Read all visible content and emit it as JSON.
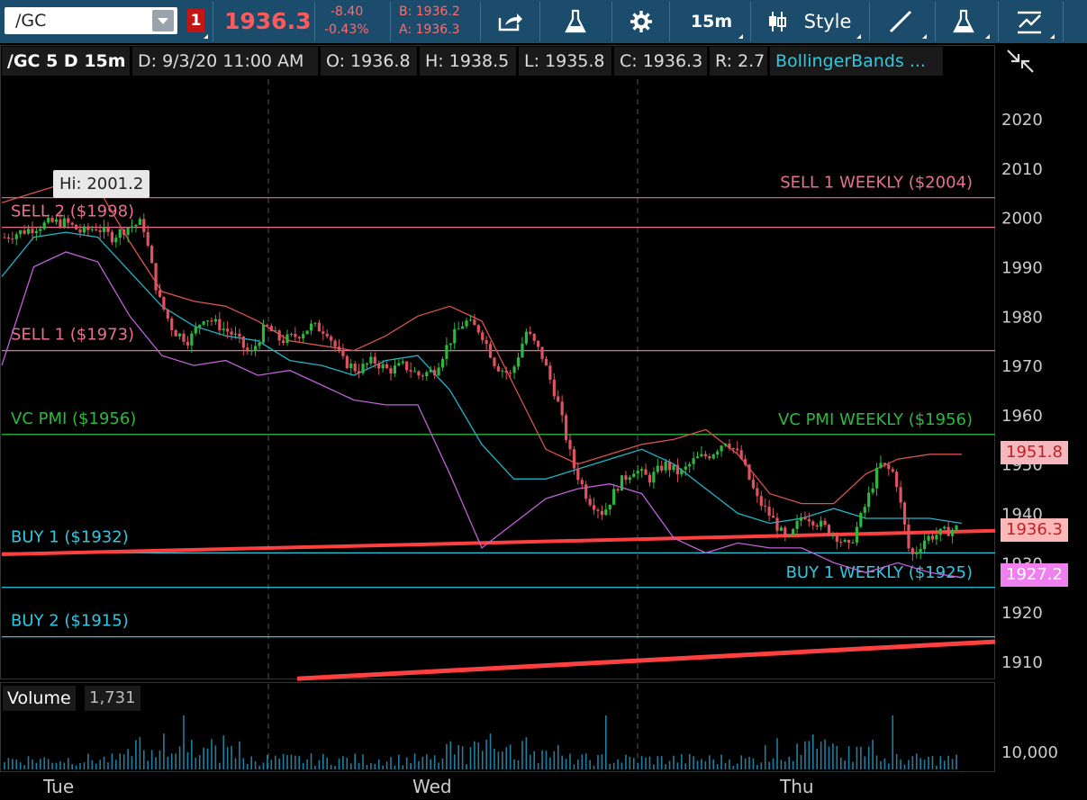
{
  "toolbar": {
    "symbol": "/GC",
    "link_badge": "1",
    "last_price": "1936.3",
    "net_change": "-8.40",
    "pct_change": "-0.43%",
    "bid": "B: 1936.2",
    "ask": "A: 1936.3",
    "timeframe": "15m",
    "style_label": "Style"
  },
  "info": {
    "title": "/GC 5 D 15m",
    "date": "D: 9/3/20 11:00 AM",
    "open": "O: 1936.8",
    "high": "H: 1938.5",
    "low": "L: 1935.8",
    "close": "C: 1936.3",
    "range": "R: 2.7",
    "study": "BollingerBands ..."
  },
  "hi_marker": "Hi: 2001.2",
  "price_axis": [
    "2020",
    "2010",
    "2000",
    "1990",
    "1980",
    "1970",
    "1960",
    "1950",
    "1940",
    "1930",
    "1920",
    "1910"
  ],
  "price_tags": {
    "upper": "1951.8",
    "last": "1936.3",
    "lower": "1927.2"
  },
  "levels": [
    {
      "label": "SELL 1 WEEKLY ($2004)",
      "price": 2004,
      "color": "#e87090",
      "side": "right"
    },
    {
      "label": "SELL 2 ($1998)",
      "price": 1998,
      "color": "#e87090",
      "side": "left"
    },
    {
      "label": "SELL 1 ($1973)",
      "price": 1973,
      "color": "#e87090",
      "side": "left"
    },
    {
      "label": "VC PMI  ($1956)",
      "price": 1956,
      "color": "#2db83d",
      "side": "left"
    },
    {
      "label": "VC PMI WEEKLY ($1956)",
      "price": 1956,
      "color": "#2db83d",
      "side": "right"
    },
    {
      "label": "BUY 1 ($1932)",
      "price": 1932,
      "color": "#2ec8e0",
      "side": "left"
    },
    {
      "label": "BUY 1 WEEKLY ($1925)",
      "price": 1925,
      "color": "#2ec8e0",
      "side": "right"
    },
    {
      "label": "BUY 2 ($1915)",
      "price": 1915,
      "color": "#2ec8e0",
      "side": "left"
    }
  ],
  "volume": {
    "label": "Volume",
    "value": "1,731",
    "axis_label": "10,000"
  },
  "days": [
    "Tue",
    "Wed",
    "Thu"
  ],
  "colors": {
    "up": "#2db83d",
    "down": "#e05260",
    "upper_band": "#d9534f",
    "mid_band": "#1fb5c8",
    "lower_band": "#c060d8",
    "trendline": "#ff4040"
  },
  "chart_data": {
    "type": "candlestick",
    "ylim": [
      1905,
      2025
    ],
    "price_path": [
      1996,
      1997,
      1998,
      1999,
      1999,
      1997,
      1998,
      1996,
      1998,
      1999,
      1984,
      1977,
      1975,
      1980,
      1978,
      1976,
      1972,
      1978,
      1975,
      1976,
      1978,
      1977,
      1971,
      1969,
      1971,
      1969,
      1970,
      1968,
      1969,
      1975,
      1979,
      1977,
      1970,
      1968,
      1977,
      1972,
      1963,
      1950,
      1943,
      1940,
      1946,
      1949,
      1947,
      1950,
      1948,
      1951,
      1952,
      1955,
      1951,
      1943,
      1939,
      1934,
      1940,
      1938,
      1936,
      1933,
      1941,
      1950,
      1948,
      1931,
      1935,
      1936,
      1937
    ],
    "upper_band": [
      2003,
      2005,
      2007,
      2006,
      1995,
      1985,
      1983,
      1982,
      1979,
      1975,
      1974,
      1973,
      1976,
      1980,
      1982,
      1979,
      1966,
      1953,
      1950,
      1952,
      1954,
      1955,
      1957,
      1952,
      1944,
      1942,
      1942,
      1948,
      1951,
      1952,
      1952
    ],
    "mid_band": [
      1988,
      1996,
      1997,
      1996,
      1989,
      1982,
      1978,
      1976,
      1975,
      1971,
      1970,
      1968,
      1971,
      1972,
      1965,
      1954,
      1947,
      1947,
      1949,
      1951,
      1953,
      1950,
      1945,
      1940,
      1938,
      1939,
      1941,
      1939,
      1939,
      1939,
      1938
    ],
    "lower_band": [
      1970,
      1990,
      1993,
      1991,
      1980,
      1972,
      1970,
      1971,
      1968,
      1969,
      1966,
      1963,
      1962,
      1962,
      1948,
      1933,
      1938,
      1943,
      1945,
      1946,
      1944,
      1935,
      1932,
      1934,
      1933,
      1933,
      1930,
      1928,
      1930,
      1928,
      1927
    ]
  }
}
